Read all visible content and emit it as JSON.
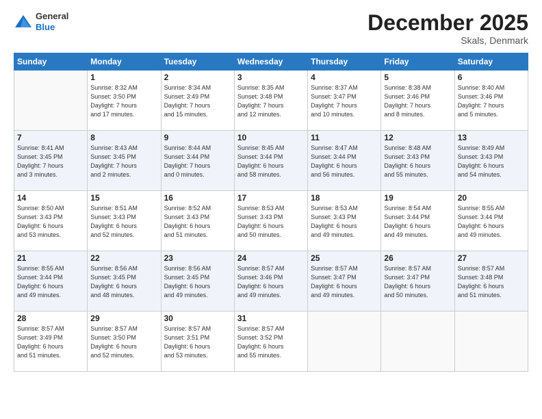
{
  "header": {
    "logo_general": "General",
    "logo_blue": "Blue",
    "month_title": "December 2025",
    "subtitle": "Skals, Denmark"
  },
  "days_of_week": [
    "Sunday",
    "Monday",
    "Tuesday",
    "Wednesday",
    "Thursday",
    "Friday",
    "Saturday"
  ],
  "weeks": [
    {
      "shaded": false,
      "days": [
        {
          "num": "",
          "info": ""
        },
        {
          "num": "1",
          "info": "Sunrise: 8:32 AM\nSunset: 3:50 PM\nDaylight: 7 hours\nand 17 minutes."
        },
        {
          "num": "2",
          "info": "Sunrise: 8:34 AM\nSunset: 3:49 PM\nDaylight: 7 hours\nand 15 minutes."
        },
        {
          "num": "3",
          "info": "Sunrise: 8:35 AM\nSunset: 3:48 PM\nDaylight: 7 hours\nand 12 minutes."
        },
        {
          "num": "4",
          "info": "Sunrise: 8:37 AM\nSunset: 3:47 PM\nDaylight: 7 hours\nand 10 minutes."
        },
        {
          "num": "5",
          "info": "Sunrise: 8:38 AM\nSunset: 3:46 PM\nDaylight: 7 hours\nand 8 minutes."
        },
        {
          "num": "6",
          "info": "Sunrise: 8:40 AM\nSunset: 3:46 PM\nDaylight: 7 hours\nand 5 minutes."
        }
      ]
    },
    {
      "shaded": true,
      "days": [
        {
          "num": "7",
          "info": "Sunrise: 8:41 AM\nSunset: 3:45 PM\nDaylight: 7 hours\nand 3 minutes."
        },
        {
          "num": "8",
          "info": "Sunrise: 8:43 AM\nSunset: 3:45 PM\nDaylight: 7 hours\nand 2 minutes."
        },
        {
          "num": "9",
          "info": "Sunrise: 8:44 AM\nSunset: 3:44 PM\nDaylight: 7 hours\nand 0 minutes."
        },
        {
          "num": "10",
          "info": "Sunrise: 8:45 AM\nSunset: 3:44 PM\nDaylight: 6 hours\nand 58 minutes."
        },
        {
          "num": "11",
          "info": "Sunrise: 8:47 AM\nSunset: 3:44 PM\nDaylight: 6 hours\nand 56 minutes."
        },
        {
          "num": "12",
          "info": "Sunrise: 8:48 AM\nSunset: 3:43 PM\nDaylight: 6 hours\nand 55 minutes."
        },
        {
          "num": "13",
          "info": "Sunrise: 8:49 AM\nSunset: 3:43 PM\nDaylight: 6 hours\nand 54 minutes."
        }
      ]
    },
    {
      "shaded": false,
      "days": [
        {
          "num": "14",
          "info": "Sunrise: 8:50 AM\nSunset: 3:43 PM\nDaylight: 6 hours\nand 53 minutes."
        },
        {
          "num": "15",
          "info": "Sunrise: 8:51 AM\nSunset: 3:43 PM\nDaylight: 6 hours\nand 52 minutes."
        },
        {
          "num": "16",
          "info": "Sunrise: 8:52 AM\nSunset: 3:43 PM\nDaylight: 6 hours\nand 51 minutes."
        },
        {
          "num": "17",
          "info": "Sunrise: 8:53 AM\nSunset: 3:43 PM\nDaylight: 6 hours\nand 50 minutes."
        },
        {
          "num": "18",
          "info": "Sunrise: 8:53 AM\nSunset: 3:43 PM\nDaylight: 6 hours\nand 49 minutes."
        },
        {
          "num": "19",
          "info": "Sunrise: 8:54 AM\nSunset: 3:44 PM\nDaylight: 6 hours\nand 49 minutes."
        },
        {
          "num": "20",
          "info": "Sunrise: 8:55 AM\nSunset: 3:44 PM\nDaylight: 6 hours\nand 49 minutes."
        }
      ]
    },
    {
      "shaded": true,
      "days": [
        {
          "num": "21",
          "info": "Sunrise: 8:55 AM\nSunset: 3:44 PM\nDaylight: 6 hours\nand 49 minutes."
        },
        {
          "num": "22",
          "info": "Sunrise: 8:56 AM\nSunset: 3:45 PM\nDaylight: 6 hours\nand 48 minutes."
        },
        {
          "num": "23",
          "info": "Sunrise: 8:56 AM\nSunset: 3:45 PM\nDaylight: 6 hours\nand 49 minutes."
        },
        {
          "num": "24",
          "info": "Sunrise: 8:57 AM\nSunset: 3:46 PM\nDaylight: 6 hours\nand 49 minutes."
        },
        {
          "num": "25",
          "info": "Sunrise: 8:57 AM\nSunset: 3:47 PM\nDaylight: 6 hours\nand 49 minutes."
        },
        {
          "num": "26",
          "info": "Sunrise: 8:57 AM\nSunset: 3:47 PM\nDaylight: 6 hours\nand 50 minutes."
        },
        {
          "num": "27",
          "info": "Sunrise: 8:57 AM\nSunset: 3:48 PM\nDaylight: 6 hours\nand 51 minutes."
        }
      ]
    },
    {
      "shaded": false,
      "days": [
        {
          "num": "28",
          "info": "Sunrise: 8:57 AM\nSunset: 3:49 PM\nDaylight: 6 hours\nand 51 minutes."
        },
        {
          "num": "29",
          "info": "Sunrise: 8:57 AM\nSunset: 3:50 PM\nDaylight: 6 hours\nand 52 minutes."
        },
        {
          "num": "30",
          "info": "Sunrise: 8:57 AM\nSunset: 3:51 PM\nDaylight: 6 hours\nand 53 minutes."
        },
        {
          "num": "31",
          "info": "Sunrise: 8:57 AM\nSunset: 3:52 PM\nDaylight: 6 hours\nand 55 minutes."
        },
        {
          "num": "",
          "info": ""
        },
        {
          "num": "",
          "info": ""
        },
        {
          "num": "",
          "info": ""
        }
      ]
    }
  ]
}
